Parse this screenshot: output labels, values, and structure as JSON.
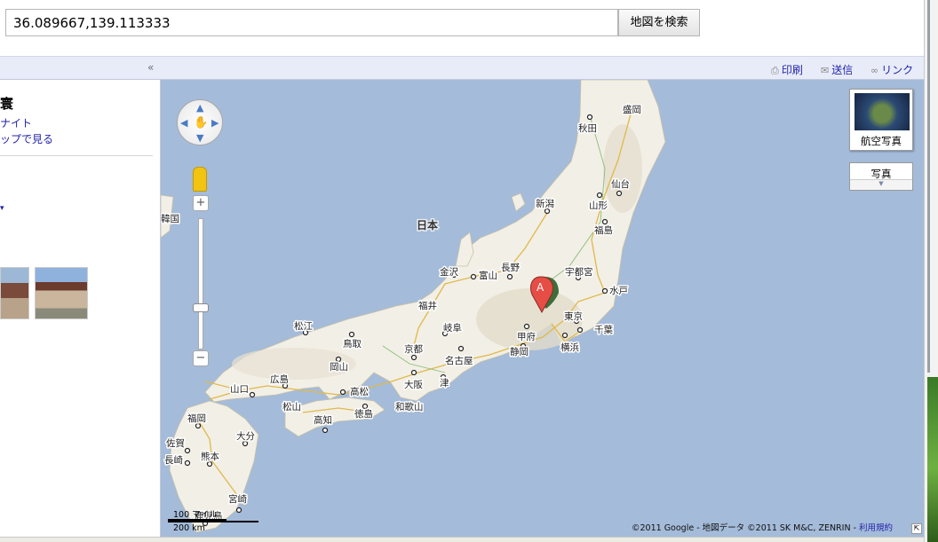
{
  "search": {
    "query": "36.089667,139.113333",
    "button_label": "地図を検索"
  },
  "toolbar": {
    "collapse_label": "«",
    "print_label": "印刷",
    "send_label": "送信",
    "link_label": "リンク"
  },
  "sidebar": {
    "title": "寰",
    "link1": "ナイト",
    "link2": "ップで見る",
    "more_label": "▾"
  },
  "map": {
    "country_label": "日本",
    "korea_label": "韓国",
    "marker_letter": "A",
    "aerial_label": "航空写真",
    "photo_label": "写真",
    "photo_arrow": "▼",
    "zoom_in": "+",
    "zoom_out": "−",
    "scale_miles": "100 マイル",
    "scale_km": "200 km",
    "copyright": "©2011 Google - 地図データ ©2011 SK M&C, ZENRIN - ",
    "terms_link": "利用規約",
    "cities": [
      "盛岡",
      "秋田",
      "仙台",
      "山形",
      "新潟",
      "福島",
      "宇都宮",
      "水戸",
      "金沢",
      "富山",
      "長野",
      "福井",
      "東京",
      "千葉",
      "甲府",
      "横浜",
      "静岡",
      "岐阜",
      "名古屋",
      "京都",
      "大阪",
      "津",
      "和歌山",
      "松江",
      "鳥取",
      "岡山",
      "広島",
      "山口",
      "高松",
      "松山",
      "徳島",
      "高知",
      "福岡",
      "佐賀",
      "長崎",
      "熊本",
      "大分",
      "宮崎",
      "鹿児島"
    ]
  },
  "colors": {
    "sea": "#a4bbd9",
    "land": "#f2efe6",
    "link": "#2323aa",
    "marker": "#e54d45"
  }
}
